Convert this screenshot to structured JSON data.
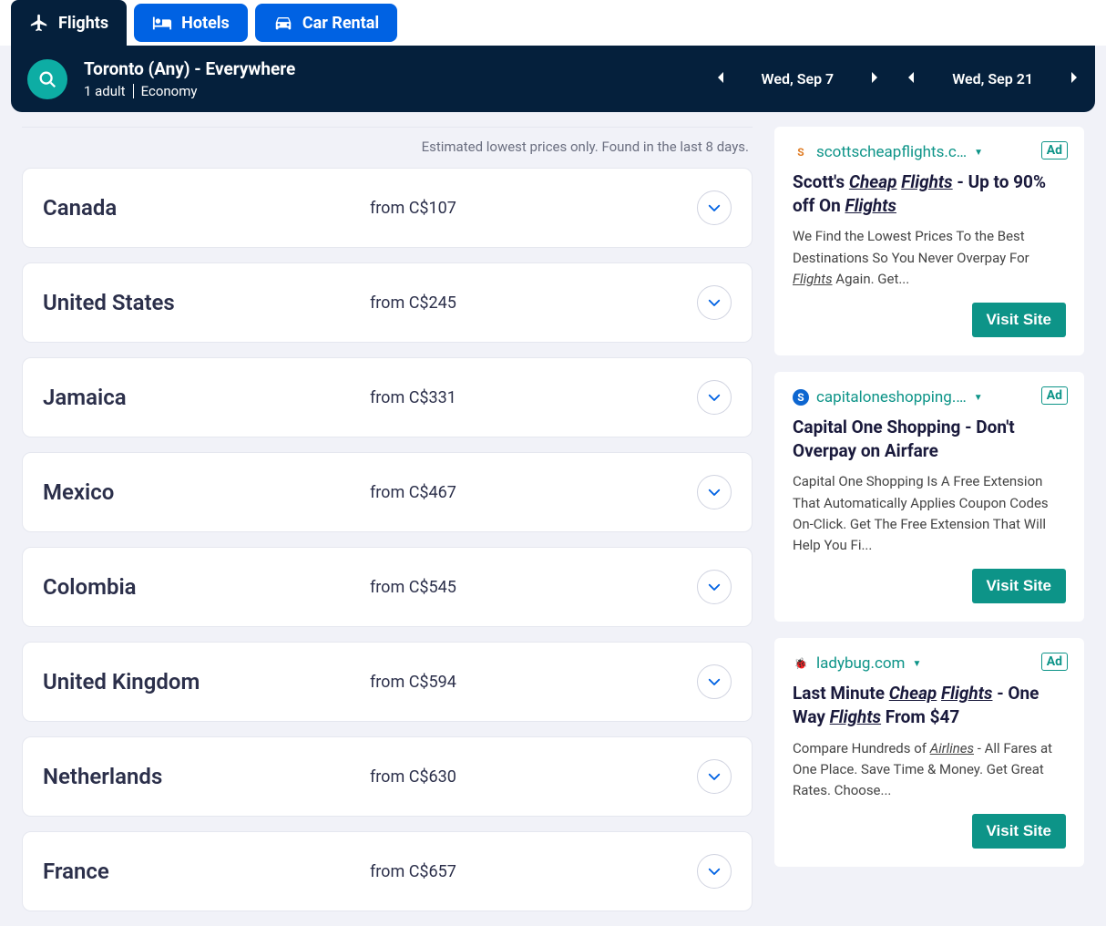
{
  "tabs": {
    "flights": "Flights",
    "hotels": "Hotels",
    "car_rental": "Car Rental"
  },
  "search": {
    "route": "Toronto (Any) - Everywhere",
    "pax": "1 adult",
    "cabin": "Economy",
    "date_out": "Wed, Sep 7",
    "date_back": "Wed, Sep 21"
  },
  "disclaimer": "Estimated lowest prices only. Found in the last 8 days.",
  "results": [
    {
      "country": "Canada",
      "price": "from C$107"
    },
    {
      "country": "United States",
      "price": "from C$245"
    },
    {
      "country": "Jamaica",
      "price": "from C$331"
    },
    {
      "country": "Mexico",
      "price": "from C$467"
    },
    {
      "country": "Colombia",
      "price": "from C$545"
    },
    {
      "country": "United Kingdom",
      "price": "from C$594"
    },
    {
      "country": "Netherlands",
      "price": "from C$630"
    },
    {
      "country": "France",
      "price": "from C$657"
    }
  ],
  "ads": [
    {
      "domain": "scottscheapflights.c…",
      "favicon_bg": "#fff",
      "favicon_fg": "#e07c24",
      "favicon_char": "S",
      "title_html": "Scott's <u>Cheap</u> <u>Flights</u> - Up to 90% off On <u>Flights</u>",
      "body_html": "We Find the Lowest Prices To the Best Destinations So You Never Overpay For <u>Flights</u> Again. Get...",
      "cta": "Visit Site"
    },
    {
      "domain": "capitaloneshopping.…",
      "favicon_bg": "#0d66d0",
      "favicon_fg": "#fff",
      "favicon_char": "S",
      "title_html": "Capital One Shopping - Don't Overpay on Airfare",
      "body_html": "Capital One Shopping Is A Free Extension That Automatically Applies Coupon Codes On-Click. Get The Free Extension That Will Help You Fi...",
      "cta": "Visit Site"
    },
    {
      "domain": "ladybug.com",
      "favicon_bg": "#fff",
      "favicon_fg": "#b02a2a",
      "favicon_char": "🐞",
      "title_html": "Last Minute <u>Cheap</u> <u>Flights</u> - One Way <u>Flights</u> From $47",
      "body_html": "Compare Hundreds of <u>Airlines</u> - All Fares at One Place. Save Time & Money. Get Great Rates. Choose...",
      "cta": "Visit Site"
    }
  ],
  "ad_label": "Ad"
}
